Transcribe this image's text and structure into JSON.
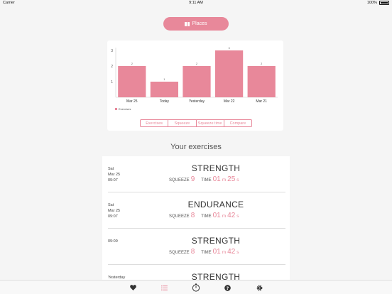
{
  "status_bar": {
    "carrier": "Carrier",
    "time": "9:11 AM",
    "battery": "100%"
  },
  "places_button": {
    "label": "Places",
    "icon": "map-icon"
  },
  "colors": {
    "accent": "#e8889a",
    "bar": "#e8889a",
    "background": "#f5f5f5"
  },
  "chart_data": {
    "type": "bar",
    "categories": [
      "Mar 25",
      "Today",
      "Yesterday",
      "Mar 22",
      "Mar 21"
    ],
    "series": [
      {
        "name": "Exercises",
        "values": [
          2,
          1,
          2,
          3,
          2
        ]
      }
    ],
    "data_labels": [
      "2",
      "1",
      "2",
      "3",
      "2"
    ],
    "ylim": [
      0,
      3
    ],
    "yticks": [
      "1",
      "2",
      "3"
    ],
    "grid": false,
    "legend": "bottom-left"
  },
  "segments": [
    {
      "label": "Exercises",
      "active": true
    },
    {
      "label": "Squeeze",
      "active": false
    },
    {
      "label": "Squeeze time",
      "active": false
    },
    {
      "label": "Compare",
      "active": false
    }
  ],
  "section_title": "Your exercises",
  "exercises": [
    {
      "date_lines": [
        "Sat",
        "Mar 25",
        "09:07"
      ],
      "type": "STRENGTH",
      "squeeze_label": "SQUEEZE",
      "squeeze": "9",
      "time_label": "TIME",
      "min": "01",
      "min_unit": "m",
      "sec": "25",
      "sec_unit": "s"
    },
    {
      "date_lines": [
        "Sat",
        "Mar 25",
        "09:07"
      ],
      "type": "ENDURANCE",
      "squeeze_label": "SQUEEZE",
      "squeeze": "8",
      "time_label": "TIME",
      "min": "01",
      "min_unit": "m",
      "sec": "42",
      "sec_unit": "s"
    },
    {
      "date_lines": [
        "",
        "",
        "09:09"
      ],
      "type": "STRENGTH",
      "squeeze_label": "SQUEEZE",
      "squeeze": "8",
      "time_label": "TIME",
      "min": "01",
      "min_unit": "m",
      "sec": "42",
      "sec_unit": "s"
    },
    {
      "date_lines": [
        "Yesterday",
        "",
        ""
      ],
      "type": "STRENGTH",
      "squeeze_label": "",
      "squeeze": "",
      "time_label": "",
      "min": "",
      "min_unit": "",
      "sec": "",
      "sec_unit": ""
    }
  ],
  "tab_bar": [
    {
      "icon": "heart-icon",
      "active": false
    },
    {
      "icon": "list-icon",
      "active": true
    },
    {
      "icon": "stopwatch-icon",
      "active": false
    },
    {
      "icon": "help-icon",
      "active": false
    },
    {
      "icon": "gear-icon",
      "active": false
    }
  ]
}
